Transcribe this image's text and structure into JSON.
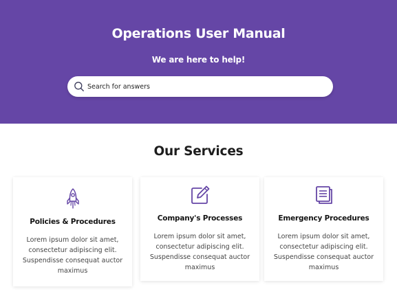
{
  "hero": {
    "title": "Operations User Manual",
    "subtitle": "We are here to help!",
    "search_placeholder": "Search for answers",
    "background_color": "#6546a6"
  },
  "services": {
    "title": "Our Services",
    "cards": [
      {
        "icon": "rocket-icon",
        "heading": "Policies & Procedures",
        "text": "Lorem ipsum dolor sit amet, consectetur adipiscing elit. Suspendisse consequat auctor maximus"
      },
      {
        "icon": "edit-icon",
        "heading": "Company's Processes",
        "text": "Lorem ipsum dolor sit amet, consectetur adipiscing elit. Suspendisse consequat auctor maximus"
      },
      {
        "icon": "documents-icon",
        "heading": "Emergency Procedures",
        "text": "Lorem ipsum dolor sit amet, consectetur adipiscing elit. Suspendisse consequat auctor maximus"
      }
    ],
    "accent_color": "#6546a6"
  }
}
